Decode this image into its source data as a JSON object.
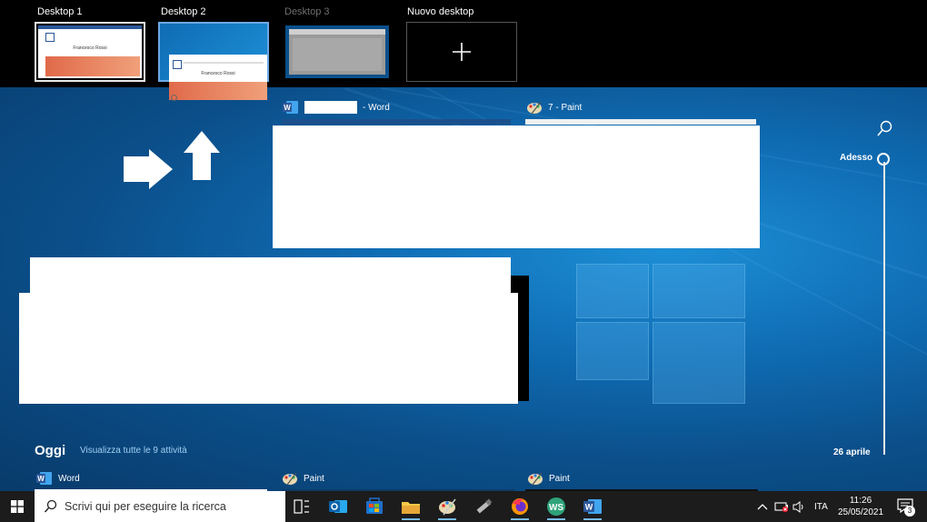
{
  "desktops": [
    {
      "label": "Desktop 1"
    },
    {
      "label": "Desktop 2"
    },
    {
      "label": "Desktop 3"
    }
  ],
  "new_desktop": {
    "label": "Nuovo desktop",
    "icon": "plus-icon"
  },
  "windows": [
    {
      "title": "- Word",
      "icon": "word-icon"
    },
    {
      "title": "7 - Paint",
      "icon": "paint-icon"
    }
  ],
  "thumb_text": {
    "d1": "Francesco Rossi",
    "d2": "Francesco Rossi"
  },
  "timeline": {
    "search_icon": "search-icon",
    "now_label": "Adesso",
    "date_label": "26 aprile",
    "section_title": "Oggi",
    "see_all": "Visualizza tutte le 9 attività",
    "activities": [
      {
        "title": "Word",
        "icon": "word-icon"
      },
      {
        "title": "Paint",
        "icon": "paint-icon"
      },
      {
        "title": "Paint",
        "icon": "paint-icon"
      }
    ]
  },
  "taskbar": {
    "search_placeholder": "Scrivi qui per eseguire la ricerca",
    "language": "ITA",
    "time": "11:26",
    "date": "25/05/2021",
    "notification_count": "3"
  },
  "colors": {
    "accent": "#0078d7",
    "taskbar": "#1c1c1c",
    "word": "#2b579a"
  }
}
